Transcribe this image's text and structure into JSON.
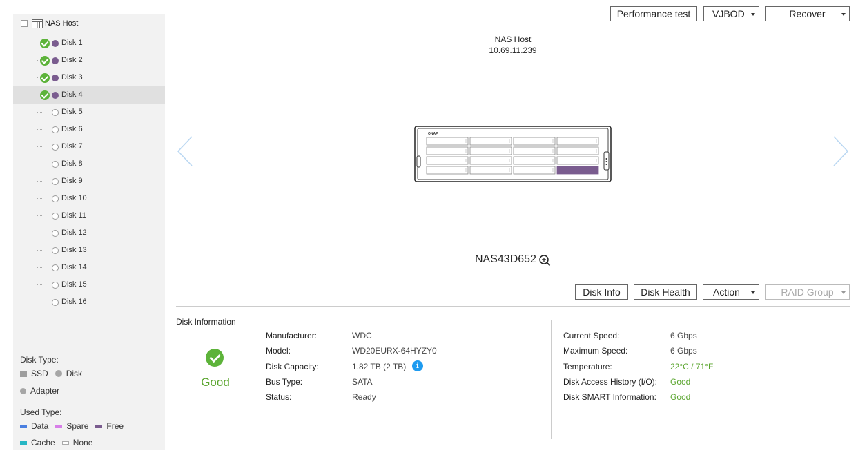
{
  "tree": {
    "root_label": "NAS Host",
    "disks": [
      {
        "label": "Disk 1",
        "status": "ok",
        "slot": "used"
      },
      {
        "label": "Disk 2",
        "status": "ok",
        "slot": "used"
      },
      {
        "label": "Disk 3",
        "status": "ok",
        "slot": "used"
      },
      {
        "label": "Disk 4",
        "status": "ok",
        "slot": "used",
        "selected": true
      },
      {
        "label": "Disk 5",
        "status": "none",
        "slot": "empty"
      },
      {
        "label": "Disk 6",
        "status": "none",
        "slot": "empty"
      },
      {
        "label": "Disk 7",
        "status": "none",
        "slot": "empty"
      },
      {
        "label": "Disk 8",
        "status": "none",
        "slot": "empty"
      },
      {
        "label": "Disk 9",
        "status": "none",
        "slot": "empty"
      },
      {
        "label": "Disk 10",
        "status": "none",
        "slot": "empty"
      },
      {
        "label": "Disk 11",
        "status": "none",
        "slot": "empty"
      },
      {
        "label": "Disk 12",
        "status": "none",
        "slot": "empty"
      },
      {
        "label": "Disk 13",
        "status": "none",
        "slot": "empty"
      },
      {
        "label": "Disk 14",
        "status": "none",
        "slot": "empty"
      },
      {
        "label": "Disk 15",
        "status": "none",
        "slot": "empty"
      },
      {
        "label": "Disk 16",
        "status": "none",
        "slot": "empty"
      }
    ]
  },
  "legend": {
    "disk_type_title": "Disk Type:",
    "ssd": "SSD",
    "disk": "Disk",
    "adapter": "Adapter",
    "used_type_title": "Used Type:",
    "data": "Data",
    "spare": "Spare",
    "free": "Free",
    "cache": "Cache",
    "none": "None"
  },
  "toolbar": {
    "performance_test": "Performance test",
    "vjbod": "VJBOD",
    "recover": "Recover"
  },
  "enclosure": {
    "host_title": "NAS Host",
    "host_ip": "10.69.11.239",
    "model": "NAS43D652",
    "brand": "QNAP"
  },
  "disk_toolbar": {
    "disk_info": "Disk Info",
    "disk_health": "Disk Health",
    "action": "Action",
    "raid_group": "RAID Group"
  },
  "disk_information": {
    "title": "Disk Information",
    "status": "Good",
    "left": [
      {
        "key": "Manufacturer:",
        "value": "WDC"
      },
      {
        "key": "Model:",
        "value": "WD20EURX-64HYZY0"
      },
      {
        "key": "Disk Capacity:",
        "value": "1.82 TB (2 TB)"
      },
      {
        "key": "Bus Type:",
        "value": "SATA"
      },
      {
        "key": "Status:",
        "value": "Ready"
      }
    ],
    "right": [
      {
        "key": "Current Speed:",
        "value": "6 Gbps"
      },
      {
        "key": "Maximum Speed:",
        "value": "6 Gbps"
      },
      {
        "key": "Temperature:",
        "value": "22°C / 71°F"
      },
      {
        "key": "Disk Access History (I/O):",
        "value": "Good"
      },
      {
        "key": "Disk SMART Information:",
        "value": "Good"
      }
    ]
  },
  "colors": {
    "used_disk": "#7a5c8f",
    "good_green": "#5aa52e",
    "info_blue": "#1e9bf0",
    "arrow_blue": "#b9d7f2"
  }
}
